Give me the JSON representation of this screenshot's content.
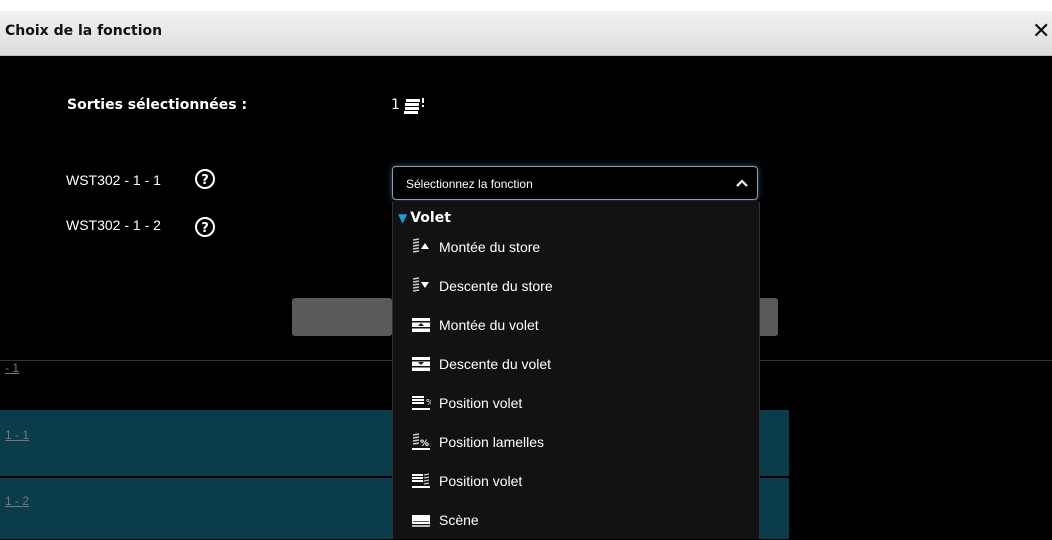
{
  "dialog": {
    "title": "Choix de la fonction",
    "close_glyph": "✕"
  },
  "selection": {
    "label": "Sorties sélectionnées :",
    "count": "1"
  },
  "outputs": [
    {
      "name": "WST302 - 1 - 1"
    },
    {
      "name": "WST302 - 1 - 2"
    }
  ],
  "select": {
    "placeholder": "Sélectionnez la fonction"
  },
  "dropdown": {
    "group": "Volet",
    "options": [
      {
        "label": "Montée du store",
        "icon": "store-up-icon"
      },
      {
        "label": "Descente du store",
        "icon": "store-down-icon"
      },
      {
        "label": "Montée du volet",
        "icon": "shutter-up-icon"
      },
      {
        "label": "Descente du volet",
        "icon": "shutter-down-icon"
      },
      {
        "label": "Position volet",
        "icon": "shutter-position-icon"
      },
      {
        "label": "Position lamelles",
        "icon": "slats-position-icon"
      },
      {
        "label": "Position volet",
        "icon": "shutter-slats-position-icon"
      },
      {
        "label": "Scène",
        "icon": "scene-icon"
      }
    ]
  },
  "background_table": {
    "rows": [
      {
        "label": "- 1"
      },
      {
        "label": "1 - 1"
      },
      {
        "label": "1 - 2"
      }
    ]
  },
  "colors": {
    "accent": "#1e9be8",
    "row_highlight": "#0a3a4a",
    "header_bg": "#e6e6e6"
  }
}
